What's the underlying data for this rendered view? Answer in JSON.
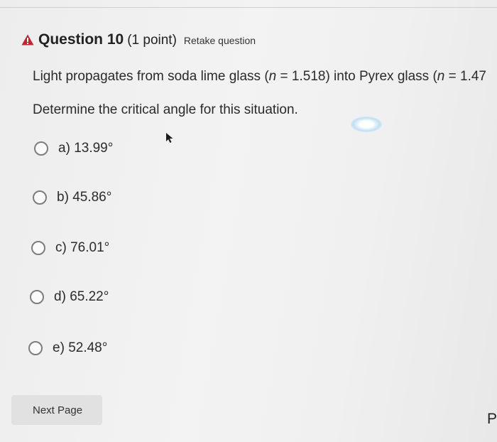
{
  "question": {
    "title": "Question 10",
    "points": "(1 point)",
    "retake": "Retake question",
    "text_part1": "Light propagates from soda lime glass (",
    "n_symbol": "n",
    "text_part2": " = 1.518) into Pyrex glass (",
    "text_part3": " = 1.47",
    "instruction": "Determine the critical angle for this situation."
  },
  "options": [
    {
      "letter": "a)",
      "value": "13.99°"
    },
    {
      "letter": "b)",
      "value": "45.86°"
    },
    {
      "letter": "c)",
      "value": "76.01°"
    },
    {
      "letter": "d)",
      "value": "65.22°"
    },
    {
      "letter": "e)",
      "value": "52.48°"
    }
  ],
  "navigation": {
    "next_label": "Next Page",
    "corner_text": "P"
  },
  "icons": {
    "warning": "warning-icon",
    "pointer": "mouse-pointer-icon"
  },
  "colors": {
    "warning_red": "#c0262d",
    "button_bg": "#e1e1e1"
  }
}
